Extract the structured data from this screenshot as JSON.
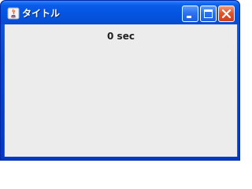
{
  "window": {
    "title": "タイトル",
    "controls": {
      "minimize_icon": "minimize-icon",
      "maximize_icon": "maximize-icon",
      "close_icon": "close-icon"
    }
  },
  "main": {
    "timer_text": "0 sec"
  },
  "colors": {
    "titlebar": "#0455e2",
    "content_bg": "#ececec",
    "close_button": "#e0562b"
  }
}
